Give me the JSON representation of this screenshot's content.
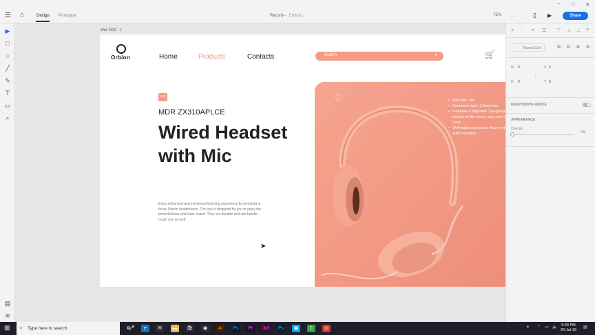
{
  "topbar": {
    "tabs": [
      "Design",
      "Prototype"
    ],
    "doc_title": "Record",
    "doc_status": "Edited",
    "zoom": "75%",
    "share_label": "Share",
    "icons": [
      "menu-icon",
      "home-icon",
      "device-icon",
      "play-icon",
      "minimize-icon",
      "maximize-icon",
      "close-icon"
    ]
  },
  "lefttools": {
    "icons": [
      "select-tool-icon",
      "rectangle-tool-icon",
      "ellipse-tool-icon",
      "line-tool-icon",
      "pen-tool-icon",
      "text-tool-icon",
      "artboard-tool-icon",
      "zoom-tool-icon",
      "assets-icon",
      "layers-icon"
    ]
  },
  "rightpanel": {
    "repeat_grid": "Repeat Grid",
    "w_label": "W",
    "w_value": "0",
    "x_label": "X",
    "x_value": "0",
    "h_label": "H",
    "h_value": "0",
    "y_label": "Y",
    "y_value": "0",
    "responsive_resize": "RESPONSIVE RESIZE",
    "appearance": "APPEARANCE",
    "opacity_label": "Opacity",
    "opacity_value": "0%"
  },
  "artboard": {
    "label": "Web 1920 – 1",
    "logo_text": "Orbion",
    "nav": [
      "Home",
      "Products",
      "Contacts"
    ],
    "search_placeholder": "Search",
    "badge": "4.2",
    "model": "MDR ZX310APLCE",
    "headline_line1": "Wired Headset",
    "headline_line2": "with Mic",
    "description": "Enjoy enhanced and immersive listening experience by investing in these Orbion headphones. The pair is designed for you to enjoy the powerful bass and clear sound. They are durable and can handle rough use as well.",
    "features": [
      "With Mic: Yes",
      "Connector type: 3.5mm hea",
      "Foldable/ Collapsible: Designed always on the move, easy stor to carry",
      "Well-balanced sound: Hear yo the artist intended"
    ],
    "accent_color": "#f59a86"
  },
  "taskbar": {
    "search_text": "Type here to search",
    "time": "5:33 PM",
    "date": "26-Jul-19"
  }
}
